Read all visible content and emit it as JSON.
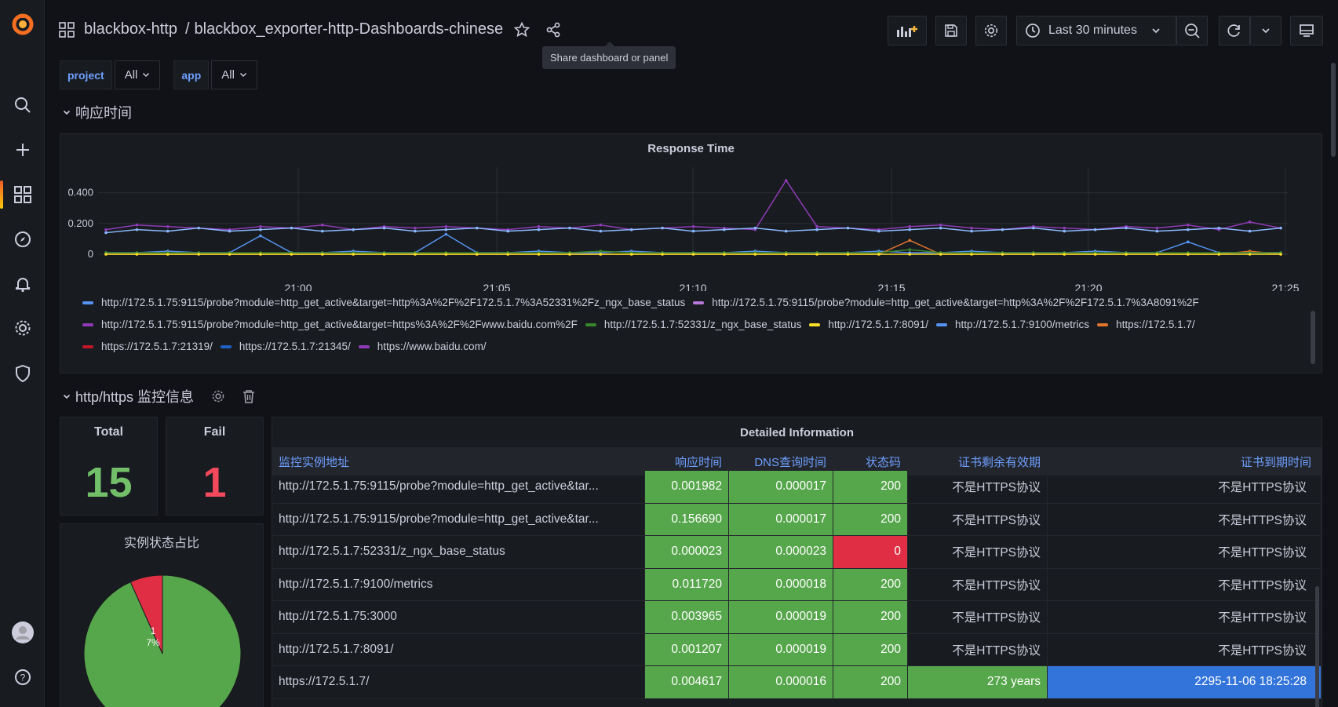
{
  "breadcrumb": {
    "folder": "blackbox-http",
    "separator": "/",
    "dashboard": "blackbox_exporter-http-Dashboards-chinese"
  },
  "tooltip": "Share dashboard or panel",
  "time_picker": {
    "label": "Last 30 minutes"
  },
  "variables": [
    {
      "label": "project",
      "value": "All"
    },
    {
      "label": "app",
      "value": "All"
    }
  ],
  "rows": {
    "response_time": "响应时间",
    "monitor_info": "http/https 监控信息"
  },
  "response_panel": {
    "title": "Response Time",
    "legend": [
      {
        "name": "http://172.5.1.75:9115/probe?module=http_get_active&target=http%3A%2F%2F172.5.1.7%3A52331%2Fz_ngx_base_status",
        "color": "#5794f2"
      },
      {
        "name": "http://172.5.1.75:9115/probe?module=http_get_active&target=http%3A%2F%2F172.5.1.7%3A8091%2F",
        "color": "#b877d9"
      },
      {
        "name": "http://172.5.1.75:9115/probe?module=http_get_active&target=https%3A%2F%2Fwww.baidu.com%2F",
        "color": "#8f3bb8"
      },
      {
        "name": "http://172.5.1.7:52331/z_ngx_base_status",
        "color": "#37872d"
      },
      {
        "name": "http://172.5.1.7:8091/",
        "color": "#fade2a"
      },
      {
        "name": "http://172.5.1.7:9100/metrics",
        "color": "#5794f2"
      },
      {
        "name": "https://172.5.1.7/",
        "color": "#e0752d"
      },
      {
        "name": "https://172.5.1.7:21319/",
        "color": "#c4162a"
      },
      {
        "name": "https://172.5.1.7:21345/",
        "color": "#1f60c4"
      },
      {
        "name": "https://www.baidu.com/",
        "color": "#8f3bb8"
      }
    ]
  },
  "chart_data": {
    "type": "line",
    "title": "Response Time",
    "x_ticks": [
      "21:00",
      "21:05",
      "21:10",
      "21:15",
      "21:20",
      "21:25"
    ],
    "y_ticks": [
      "0",
      "0.200",
      "0.400"
    ],
    "ylim": [
      0,
      0.5
    ],
    "grid": true,
    "legend_position": "bottom",
    "series": [
      {
        "name": "https://www.baidu.com/",
        "color": "#8f3bb8",
        "values": [
          0.16,
          0.19,
          0.18,
          0.17,
          0.16,
          0.18,
          0.17,
          0.19,
          0.16,
          0.18,
          0.17,
          0.18,
          0.17,
          0.16,
          0.18,
          0.17,
          0.19,
          0.16,
          0.17,
          0.18,
          0.17,
          0.16,
          0.48,
          0.18,
          0.17,
          0.16,
          0.18,
          0.19,
          0.17,
          0.16,
          0.18,
          0.17,
          0.16,
          0.18,
          0.17,
          0.19,
          0.16,
          0.21,
          0.17
        ]
      },
      {
        "name": "http://172.5.1.75:9115/probe?module=http_get_active&target=https%3A%2F%2Fwww.baidu.com%2F",
        "color": "#8ab8ff",
        "values": [
          0.14,
          0.16,
          0.15,
          0.17,
          0.15,
          0.16,
          0.17,
          0.15,
          0.16,
          0.17,
          0.15,
          0.16,
          0.17,
          0.15,
          0.16,
          0.17,
          0.15,
          0.16,
          0.17,
          0.15,
          0.16,
          0.17,
          0.15,
          0.16,
          0.17,
          0.15,
          0.16,
          0.17,
          0.15,
          0.16,
          0.17,
          0.15,
          0.16,
          0.17,
          0.15,
          0.16,
          0.17,
          0.15,
          0.17
        ]
      },
      {
        "name": "http://172.5.1.7:9100/metrics",
        "color": "#5794f2",
        "values": [
          0.01,
          0.01,
          0.02,
          0.01,
          0.01,
          0.12,
          0.01,
          0.01,
          0.02,
          0.01,
          0.01,
          0.13,
          0.01,
          0.01,
          0.02,
          0.01,
          0.01,
          0.02,
          0.01,
          0.01,
          0.01,
          0.02,
          0.01,
          0.01,
          0.01,
          0.02,
          0.01,
          0.01,
          0.02,
          0.01,
          0.01,
          0.01,
          0.02,
          0.01,
          0.01,
          0.08,
          0.01,
          0.01,
          0.01
        ]
      },
      {
        "name": "https://172.5.1.7/",
        "color": "#e0752d",
        "values": [
          0,
          0,
          0,
          0,
          0,
          0,
          0,
          0,
          0,
          0,
          0,
          0,
          0,
          0,
          0,
          0,
          0,
          0,
          0,
          0,
          0,
          0,
          0,
          0,
          0,
          0,
          0.09,
          0,
          0,
          0,
          0,
          0,
          0,
          0,
          0,
          0,
          0,
          0.02,
          0
        ]
      },
      {
        "name": "http://172.5.1.7:52331/z_ngx_base_status",
        "color": "#37872d",
        "values": [
          0.01,
          0.01,
          0.01,
          0.01,
          0.01,
          0.01,
          0.01,
          0.01,
          0.01,
          0.01,
          0.01,
          0.01,
          0.01,
          0.01,
          0.01,
          0.01,
          0.02,
          0.01,
          0.01,
          0.01,
          0.01,
          0.01,
          0.01,
          0.01,
          0.01,
          0.01,
          0.03,
          0.01,
          0.01,
          0.01,
          0.01,
          0.01,
          0.01,
          0.01,
          0.01,
          0.01,
          0.01,
          0.01,
          0.01
        ]
      },
      {
        "name": "http://172.5.1.7:8091/",
        "color": "#fade2a",
        "values": [
          0,
          0,
          0,
          0,
          0,
          0,
          0,
          0,
          0,
          0,
          0,
          0,
          0,
          0,
          0,
          0,
          0,
          0,
          0,
          0,
          0,
          0,
          0,
          0,
          0,
          0,
          0,
          0,
          0,
          0,
          0,
          0,
          0,
          0,
          0,
          0,
          0,
          0,
          0
        ]
      }
    ]
  },
  "stats": {
    "total": {
      "title": "Total",
      "value": "15",
      "color": "#73bf69"
    },
    "fail": {
      "title": "Fail",
      "value": "1",
      "color": "#f2495c"
    }
  },
  "pie": {
    "title": "实例状态占比",
    "slice_label": "1",
    "slice_pct": "7%",
    "slices": [
      {
        "value": 14,
        "color": "#56a64b"
      },
      {
        "value": 1,
        "color": "#e02f44"
      }
    ]
  },
  "table": {
    "title": "Detailed Information",
    "headers": [
      "监控实例地址",
      "响应时间",
      "DNS查询时间",
      "状态码",
      "证书剩余有效期",
      "证书到期时间"
    ],
    "rows": [
      [
        "http://172.5.1.75:9115/probe?module=http_get_active&tar...",
        "0.001982",
        "0.000017",
        "200",
        "不是HTTPS协议",
        "不是HTTPS协议"
      ],
      [
        "http://172.5.1.75:9115/probe?module=http_get_active&tar...",
        "0.156690",
        "0.000017",
        "200",
        "不是HTTPS协议",
        "不是HTTPS协议"
      ],
      [
        "http://172.5.1.7:52331/z_ngx_base_status",
        "0.000023",
        "0.000023",
        "0",
        "不是HTTPS协议",
        "不是HTTPS协议"
      ],
      [
        "http://172.5.1.7:9100/metrics",
        "0.011720",
        "0.000018",
        "200",
        "不是HTTPS协议",
        "不是HTTPS协议"
      ],
      [
        "http://172.5.1.75:3000",
        "0.003965",
        "0.000019",
        "200",
        "不是HTTPS协议",
        "不是HTTPS协议"
      ],
      [
        "http://172.5.1.7:8091/",
        "0.001207",
        "0.000019",
        "200",
        "不是HTTPS协议",
        "不是HTTPS协议"
      ],
      [
        "https://172.5.1.7/",
        "0.004617",
        "0.000016",
        "200",
        "273 years",
        "2295-11-06 18:25:28"
      ]
    ]
  }
}
